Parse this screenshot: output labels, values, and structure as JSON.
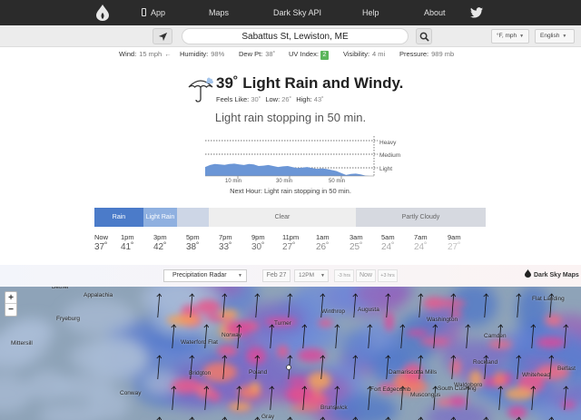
{
  "nav": {
    "app": "App",
    "maps": "Maps",
    "api": "Dark Sky API",
    "help": "Help",
    "about": "About"
  },
  "search": {
    "location": "Sabattus St, Lewiston, ME",
    "units": "°F, mph",
    "language": "English"
  },
  "stats": {
    "wind_label": "Wind:",
    "wind_value": "15 mph",
    "humidity_label": "Humidity:",
    "humidity_value": "98%",
    "dewpt_label": "Dew Pt:",
    "dewpt_value": "38˚",
    "uv_label": "UV Index:",
    "uv_value": "2",
    "visibility_label": "Visibility:",
    "visibility_value": "4 mi",
    "pressure_label": "Pressure:",
    "pressure_value": "989 mb"
  },
  "current": {
    "title": "39˚ Light Rain and Windy.",
    "feels_label": "Feels Like:",
    "feels_value": "30˚",
    "low_label": "Low:",
    "low_value": "26˚",
    "high_label": "High:",
    "high_value": "43˚",
    "summary": "Light rain stopping in 50 min."
  },
  "minutely": {
    "levels": [
      "Heavy",
      "Medium",
      "Light"
    ],
    "ticks": [
      "10 min",
      "30 min",
      "50 min"
    ],
    "next_hour": "Next Hour: Light rain stopping in 50 min.",
    "intensity": [
      0.45,
      0.55,
      0.6,
      0.58,
      0.56,
      0.6,
      0.62,
      0.58,
      0.55,
      0.6,
      0.58,
      0.5,
      0.52,
      0.55,
      0.5,
      0.45,
      0.48,
      0.5,
      0.44,
      0.4,
      0.42,
      0.45,
      0.4,
      0.36,
      0.38,
      0.35,
      0.3,
      0.25,
      0.15,
      0.05,
      0.1,
      0.12,
      0.08,
      0.02,
      0
    ]
  },
  "timeline": {
    "segments": [
      {
        "label": "Rain",
        "color": "#4b7bc9",
        "text_color": "#ffffff"
      },
      {
        "label": "Light Rain",
        "color": "#8fb0e0",
        "text_color": "#ffffff"
      },
      {
        "label": "",
        "color": "#cdd6e6",
        "text_color": "#555555"
      },
      {
        "label": "Clear",
        "color": "#eeeeee",
        "text_color": "#666666"
      },
      {
        "label": "Partly Cloudy",
        "color": "#d6d9e0",
        "text_color": "#666666"
      }
    ],
    "hours": [
      {
        "time": "Now",
        "temp": "37˚"
      },
      {
        "time": "1pm",
        "temp": "41˚"
      },
      {
        "time": "3pm",
        "temp": "42˚"
      },
      {
        "time": "5pm",
        "temp": "38˚"
      },
      {
        "time": "7pm",
        "temp": "33˚"
      },
      {
        "time": "9pm",
        "temp": "30˚"
      },
      {
        "time": "11pm",
        "temp": "27˚"
      },
      {
        "time": "1am",
        "temp": "26˚"
      },
      {
        "time": "3am",
        "temp": "25˚"
      },
      {
        "time": "5am",
        "temp": "24˚"
      },
      {
        "time": "7am",
        "temp": "24˚"
      },
      {
        "time": "9am",
        "temp": "27˚"
      }
    ]
  },
  "map_toolbar": {
    "layer": "Precipitation Radar",
    "date": "Feb 27",
    "time": "12PM",
    "back": "-3 hrs",
    "now": "Now",
    "forward": "+3 hrs",
    "brand": "Dark Sky Maps"
  },
  "map": {
    "zoom_in": "+",
    "zoom_out": "−",
    "towns": [
      {
        "name": "Bethel"
      },
      {
        "name": "Appalachia"
      },
      {
        "name": "Fryeburg"
      },
      {
        "name": "Mittersill"
      },
      {
        "name": "Turner"
      },
      {
        "name": "Norway"
      },
      {
        "name": "Waterford Flat"
      },
      {
        "name": "Poland"
      },
      {
        "name": "Bridgton"
      },
      {
        "name": "Conway"
      },
      {
        "name": "Gray"
      },
      {
        "name": "Winthrop"
      },
      {
        "name": "Augusta"
      },
      {
        "name": "Washington"
      },
      {
        "name": "Camden"
      },
      {
        "name": "Flat Landing"
      },
      {
        "name": "Rockland"
      },
      {
        "name": "Damariscotta Mills"
      },
      {
        "name": "Waldoboro"
      },
      {
        "name": "Fort Edgecomb"
      },
      {
        "name": "South Cushing"
      },
      {
        "name": "Muscongus"
      },
      {
        "name": "Brunswick"
      },
      {
        "name": "Whitehead"
      },
      {
        "name": "Belfast"
      }
    ]
  }
}
